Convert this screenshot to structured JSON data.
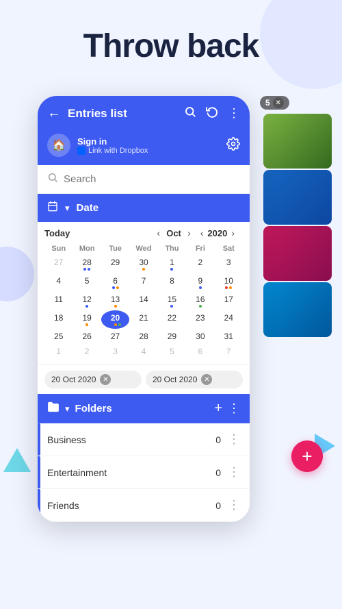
{
  "page": {
    "title": "Throw back"
  },
  "topbar": {
    "back_label": "←",
    "title": "Entries list",
    "search_icon": "search",
    "history_icon": "history",
    "more_icon": "⋮"
  },
  "signin": {
    "label": "Sign in",
    "dropbox_label": "Link with Dropbox",
    "home_icon": "🏠",
    "gear_icon": "⚙"
  },
  "search": {
    "placeholder": "Search"
  },
  "date_section": {
    "icon": "📅",
    "title": "Date",
    "chevron": "▾"
  },
  "calendar": {
    "today_label": "Today",
    "month": "Oct",
    "year": "2020",
    "day_headers": [
      "Sun",
      "Mon",
      "Tue",
      "Wed",
      "Thu",
      "Fri",
      "Sat"
    ],
    "rows": [
      [
        {
          "day": "27",
          "other": true,
          "dots": []
        },
        {
          "day": "28",
          "other": false,
          "dots": [
            "blue",
            "blue"
          ]
        },
        {
          "day": "29",
          "other": false,
          "dots": []
        },
        {
          "day": "30",
          "other": false,
          "dots": [
            "orange"
          ]
        },
        {
          "day": "1",
          "other": false,
          "dots": [
            "blue"
          ]
        },
        {
          "day": "2",
          "other": false,
          "dots": []
        },
        {
          "day": "3",
          "other": false,
          "dots": []
        }
      ],
      [
        {
          "day": "4",
          "other": false,
          "dots": []
        },
        {
          "day": "5",
          "other": false,
          "dots": []
        },
        {
          "day": "6",
          "other": false,
          "dots": [
            "blue",
            "orange"
          ]
        },
        {
          "day": "7",
          "other": false,
          "dots": []
        },
        {
          "day": "8",
          "other": false,
          "dots": []
        },
        {
          "day": "9",
          "other": false,
          "dots": [
            "blue"
          ]
        },
        {
          "day": "10",
          "other": false,
          "dots": [
            "red",
            "orange"
          ]
        }
      ],
      [
        {
          "day": "11",
          "other": false,
          "dots": []
        },
        {
          "day": "12",
          "other": false,
          "dots": [
            "blue"
          ]
        },
        {
          "day": "13",
          "other": false,
          "dots": [
            "orange"
          ]
        },
        {
          "day": "14",
          "other": false,
          "dots": []
        },
        {
          "day": "15",
          "other": false,
          "dots": [
            "blue"
          ]
        },
        {
          "day": "16",
          "other": false,
          "dots": [
            "green"
          ]
        },
        {
          "day": "17",
          "other": false,
          "dots": []
        }
      ],
      [
        {
          "day": "18",
          "other": false,
          "dots": []
        },
        {
          "day": "19",
          "other": false,
          "dots": [
            "orange"
          ]
        },
        {
          "day": "20",
          "other": false,
          "selected": true,
          "dots": [
            "blue",
            "orange",
            "green"
          ]
        },
        {
          "day": "21",
          "other": false,
          "dots": []
        },
        {
          "day": "22",
          "other": false,
          "dots": []
        },
        {
          "day": "23",
          "other": false,
          "dots": []
        },
        {
          "day": "24",
          "other": false,
          "dots": []
        }
      ],
      [
        {
          "day": "25",
          "other": false,
          "dots": []
        },
        {
          "day": "26",
          "other": false,
          "dots": []
        },
        {
          "day": "27",
          "other": false,
          "dots": []
        },
        {
          "day": "28",
          "other": false,
          "dots": []
        },
        {
          "day": "29",
          "other": false,
          "dots": []
        },
        {
          "day": "30",
          "other": false,
          "dots": []
        },
        {
          "day": "31",
          "other": false,
          "dots": []
        }
      ],
      [
        {
          "day": "1",
          "other": true,
          "dots": []
        },
        {
          "day": "2",
          "other": true,
          "dots": []
        },
        {
          "day": "3",
          "other": true,
          "dots": []
        },
        {
          "day": "4",
          "other": true,
          "dots": []
        },
        {
          "day": "5",
          "other": true,
          "dots": []
        },
        {
          "day": "6",
          "other": true,
          "dots": []
        },
        {
          "day": "7",
          "other": true,
          "dots": []
        }
      ]
    ]
  },
  "date_range": {
    "start": "20 Oct 2020",
    "end": "20 Oct 2020"
  },
  "folders_section": {
    "icon": "📁",
    "title": "Folders",
    "add_icon": "+",
    "more_icon": "⋮",
    "chevron": "▾"
  },
  "folders": [
    {
      "name": "Business",
      "count": "0"
    },
    {
      "name": "Entertainment",
      "count": "0"
    },
    {
      "name": "Friends",
      "count": "0"
    }
  ],
  "badge": {
    "count": "5",
    "close": "✕"
  },
  "fab": {
    "icon": "+"
  }
}
